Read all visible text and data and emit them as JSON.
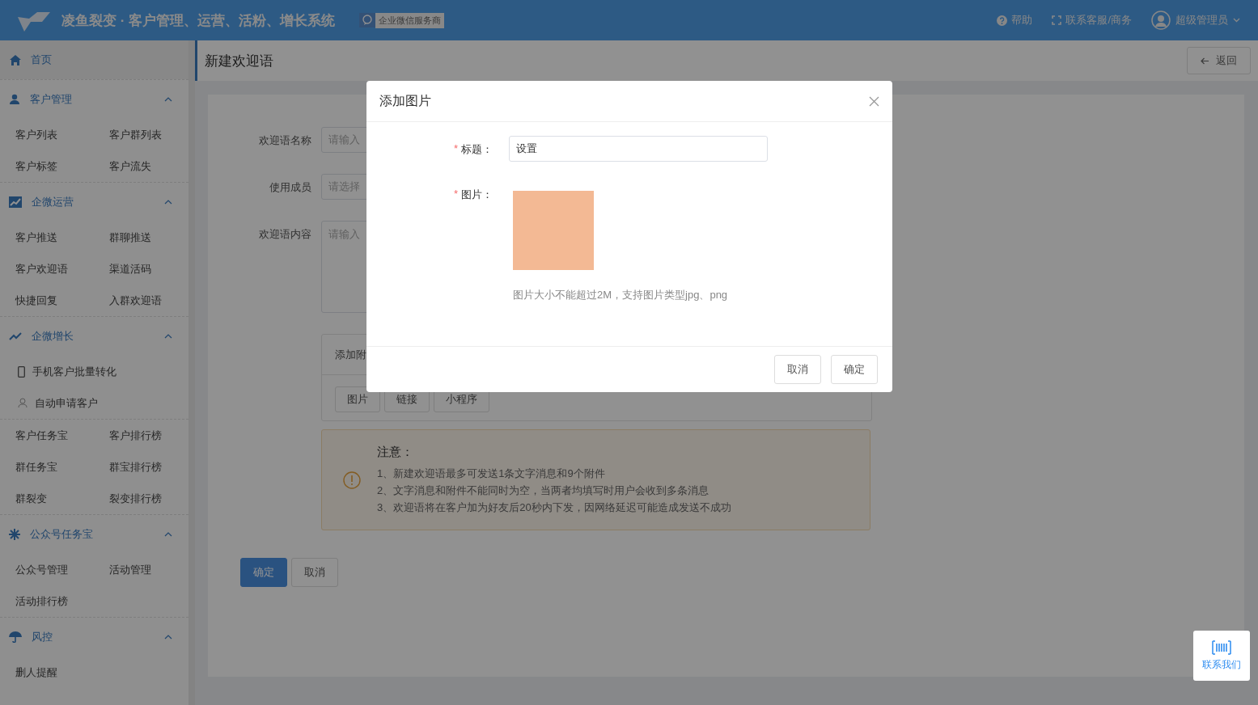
{
  "header": {
    "title": "凌鱼裂变 · 客户管理、运营、活粉、增长系统",
    "badge": "企业微信服务商",
    "actions": [
      {
        "kind": "help",
        "label": "帮助"
      },
      {
        "kind": "contact",
        "label": "联系客服/商务"
      }
    ],
    "user": {
      "name": "超级管理员"
    }
  },
  "sidebar": {
    "home": "首页",
    "groups": [
      {
        "title": "客户管理",
        "expanded": true,
        "sections": [
          {
            "kind": "grid",
            "items": [
              "客户列表",
              "客户群列表",
              "客户标签",
              "客户流失"
            ]
          }
        ]
      },
      {
        "title": "企微运营",
        "expanded": true,
        "sections": [
          {
            "kind": "grid",
            "items": [
              "客户推送",
              "群聊推送",
              "客户欢迎语",
              "渠道活码",
              "快捷回复",
              "入群欢迎语"
            ]
          }
        ]
      },
      {
        "title": "企微增长",
        "expanded": true,
        "sections": [
          {
            "kind": "list",
            "items": [
              "手机客户批量转化",
              "自动申请客户"
            ]
          },
          {
            "kind": "grid",
            "items": [
              "客户任务宝",
              "客户排行榜",
              "群任务宝",
              "群宝排行榜",
              "群裂变",
              "裂变排行榜"
            ]
          }
        ]
      },
      {
        "title": "公众号任务宝",
        "expanded": true,
        "sections": [
          {
            "kind": "grid",
            "items": [
              "公众号管理",
              "活动管理",
              "活动排行榜"
            ]
          }
        ]
      },
      {
        "title": "风控",
        "expanded": true,
        "sections": [
          {
            "kind": "grid",
            "items": [
              "删人提醒"
            ]
          }
        ]
      }
    ]
  },
  "page": {
    "title": "新建欢迎语",
    "back": "返回"
  },
  "form": {
    "fields": [
      {
        "label": "欢迎语名称",
        "placeholder": "请输入",
        "kind": "input"
      },
      {
        "label": "使用成员",
        "placeholder": "请选择",
        "kind": "input"
      },
      {
        "label": "欢迎语内容",
        "placeholder": "请输入",
        "kind": "textarea"
      }
    ],
    "attachments": {
      "title": "添加附",
      "buttons": [
        "图片",
        "链接",
        "小程序"
      ]
    },
    "notice": {
      "title": "注意：",
      "lines": [
        "1、新建欢迎语最多可发送1条文字消息和9个附件",
        "2、文字消息和附件不能同时为空，当两者均填写时用户会收到多条消息",
        "3、欢迎语将在客户加为好友后20秒内下发，因网络延迟可能造成发送不成功"
      ]
    },
    "buttons": [
      {
        "label": "确定",
        "kind": "primary"
      },
      {
        "label": "取消",
        "kind": "default"
      }
    ]
  },
  "dialog": {
    "title": "添加图片",
    "fields": [
      {
        "label": "标题：",
        "required_mark": "*",
        "kind": "input",
        "value": "设置"
      },
      {
        "label": "图片：",
        "required_mark": "*",
        "kind": "image",
        "hint": "图片大小不能超过2M，支持图片类型jpg、png"
      }
    ],
    "buttons": [
      "取消",
      "确定"
    ]
  },
  "contact_widget": {
    "label": "联系我们"
  }
}
